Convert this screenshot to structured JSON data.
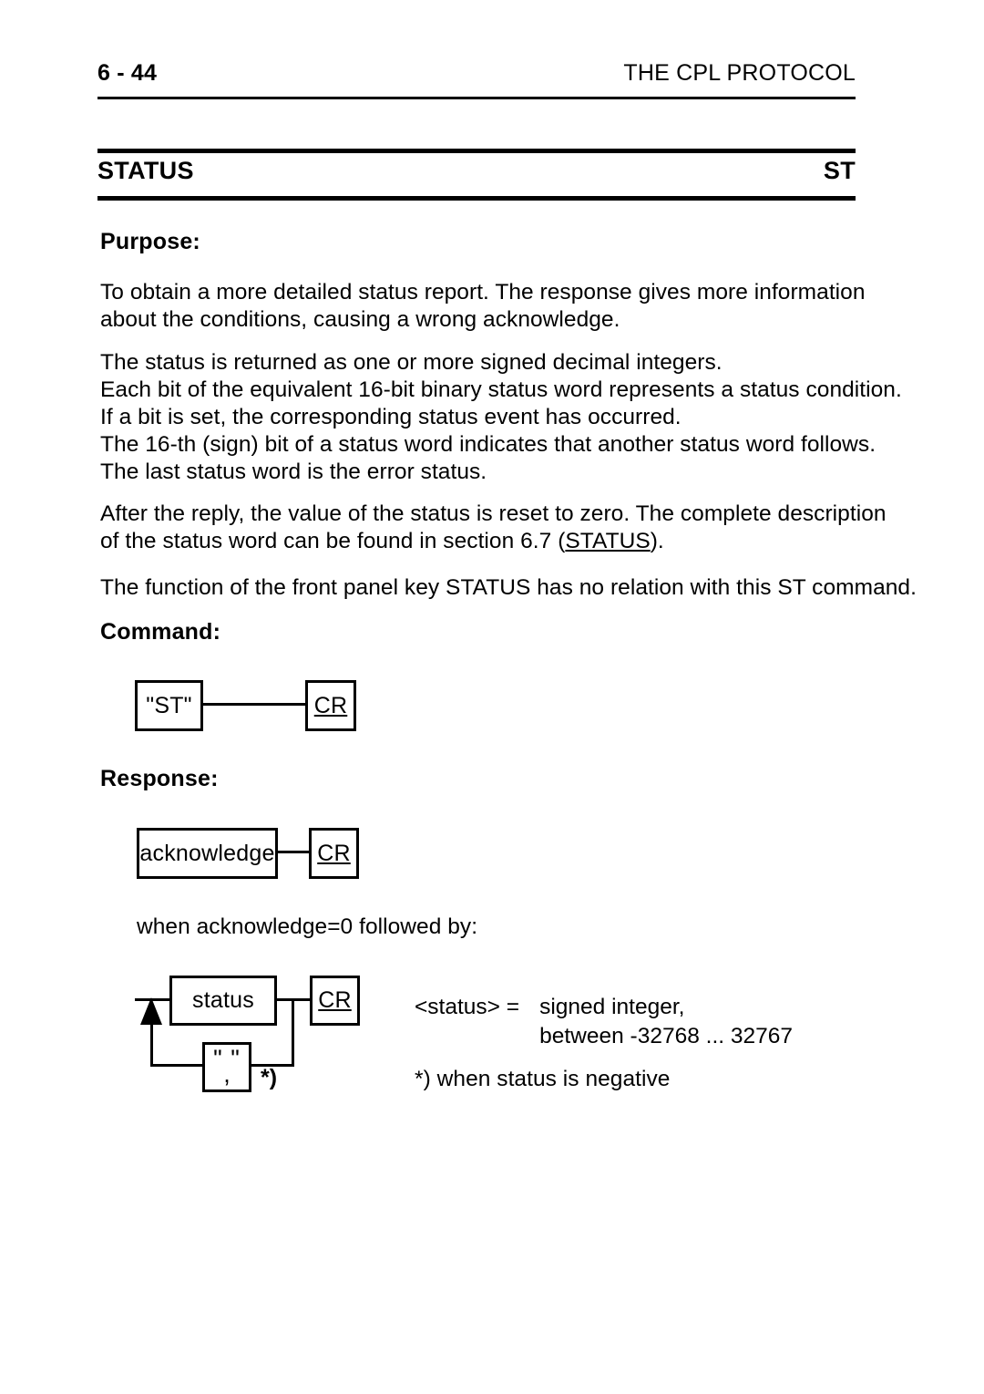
{
  "header": {
    "page_number": "6 - 44",
    "document_title": "THE CPL PROTOCOL"
  },
  "command_band": {
    "name": "STATUS",
    "mnemonic": "ST"
  },
  "sections": {
    "purpose_heading": "Purpose:",
    "command_heading": "Command:",
    "response_heading": "Response:"
  },
  "purpose": {
    "paragraph_1_line_1": "To obtain a more detailed status report. The response gives more information",
    "paragraph_1_line_2": "about the conditions, causing a wrong acknowledge.",
    "paragraph_2_line_1": "The status is returned as one or more signed decimal integers.",
    "paragraph_2_line_2": "Each bit of the equivalent 16-bit binary status word represents a status condition.",
    "paragraph_2_line_3": "If a bit is set, the corresponding status event has occurred.",
    "paragraph_2_line_4": "The 16-th (sign) bit of a status word indicates that another status word follows.",
    "paragraph_2_line_5": "The last status word is the error status.",
    "paragraph_3_line_1_prefix": "After the reply, the value of the status is reset to zero. The complete description",
    "paragraph_3_line_2_prefix": "of the status word can be found in section 6.7 (",
    "paragraph_3_line_2_link": "STATUS",
    "paragraph_3_line_2_suffix": ").",
    "paragraph_4_line_1": "The function of the front panel key STATUS has no relation with this ST command."
  },
  "command_diagram": {
    "token_box": "\"ST\"",
    "terminator_box": "CR"
  },
  "response_diagram": {
    "acknowledge_box": "acknowledge",
    "terminator_box": "CR",
    "continuation_note": "when acknowledge=0 followed by:"
  },
  "status_diagram": {
    "status_box": "status",
    "terminator_box": "CR",
    "separator_box_quotes": "\" \"",
    "separator_box_comma": ",",
    "loop_footnote_marker": "*)"
  },
  "legend": {
    "term_label": "<status> =",
    "term_definition_line_1": "signed integer,",
    "term_definition_line_2": "between -32768 ... 32767",
    "footnote": "*) when status is negative"
  }
}
